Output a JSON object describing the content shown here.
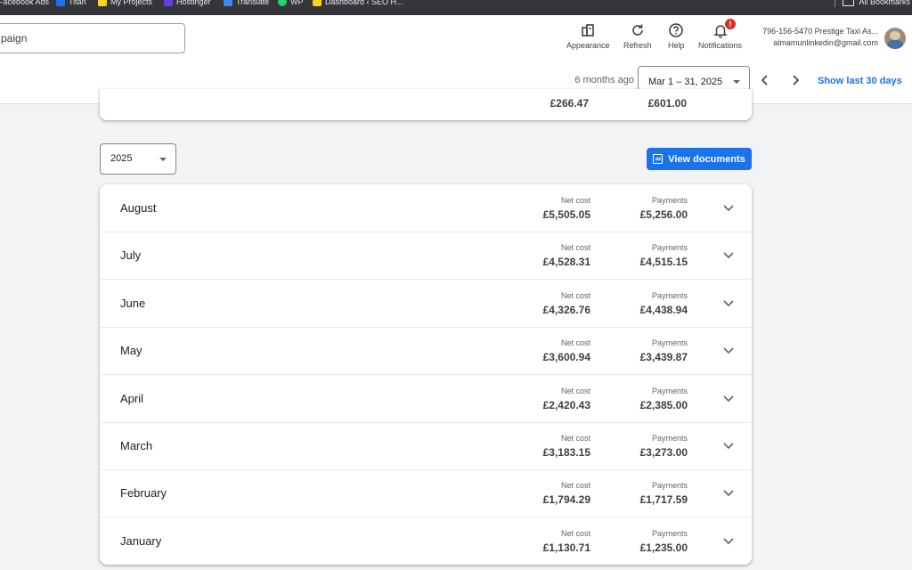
{
  "bookmarks": {
    "items": [
      {
        "label": "Facebook Ads",
        "icon": "facebook-icon",
        "color": "#1877f2"
      },
      {
        "label": "Titan",
        "icon": "mail-icon",
        "color": "#1a73e8"
      },
      {
        "label": "My Projects",
        "icon": "projects-icon",
        "color": "#f9d71c"
      },
      {
        "label": "Hostinger",
        "icon": "hostinger-icon",
        "color": "#673de6"
      },
      {
        "label": "Translate",
        "icon": "translate-icon",
        "color": "#4285f4"
      },
      {
        "label": "WP",
        "icon": "whatsapp-icon",
        "color": "#25d366"
      },
      {
        "label": "Dashboard ‹ SEO H...",
        "icon": "dashboard-icon",
        "color": "#f9d71c"
      }
    ],
    "all_bookmarks_label": "All Bookmarks"
  },
  "header": {
    "search_text": "paign",
    "tools": [
      {
        "label": "Appearance",
        "icon": "appearance-icon"
      },
      {
        "label": "Refresh",
        "icon": "refresh-icon"
      },
      {
        "label": "Help",
        "icon": "help-icon"
      },
      {
        "label": "Notifications",
        "icon": "bell-icon",
        "badge": "!"
      }
    ],
    "account": {
      "name": "796-156-5470 Prestige Taxi As...",
      "email": "almamunlinkedin@gmail.com"
    },
    "date_range": {
      "ago": "6 months ago",
      "selected": "Mar 1 – 31, 2025",
      "show_last": "Show last 30 days"
    }
  },
  "previous_card": {
    "net_cost": "£266.47",
    "payments": "£601.00"
  },
  "year_select": "2025",
  "view_documents_label": "View documents",
  "labels": {
    "net_cost": "Net cost",
    "payments": "Payments"
  },
  "months": [
    {
      "name": "August",
      "net_cost": "£5,505.05",
      "payments": "£5,256.00"
    },
    {
      "name": "July",
      "net_cost": "£4,528.31",
      "payments": "£4,515.15"
    },
    {
      "name": "June",
      "net_cost": "£4,326.76",
      "payments": "£4,438.94"
    },
    {
      "name": "May",
      "net_cost": "£3,600.94",
      "payments": "£3,439.87"
    },
    {
      "name": "April",
      "net_cost": "£2,420.43",
      "payments": "£2,385.00"
    },
    {
      "name": "March",
      "net_cost": "£3,183.15",
      "payments": "£3,273.00"
    },
    {
      "name": "February",
      "net_cost": "£1,794.29",
      "payments": "£1,717.59"
    },
    {
      "name": "January",
      "net_cost": "£1,130.71",
      "payments": "£1,235.00"
    }
  ],
  "colors": {
    "accent": "#1a73e8",
    "bookmark_bar": "#35363a",
    "page_bg": "#f1f3f4",
    "badge": "#d93025"
  }
}
